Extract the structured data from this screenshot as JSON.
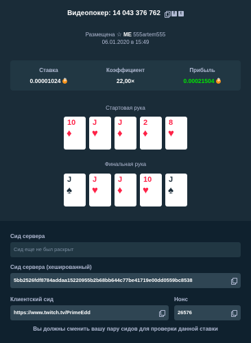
{
  "header": {
    "title": "Видеопокер: 14 043 376 762",
    "placed_prefix": "Размещена",
    "me_label": "ME",
    "username": "555artem555",
    "date": "06.01.2020 в 15:49"
  },
  "stats": {
    "bet_label": "Ставка",
    "bet_value": "0.00001024",
    "multiplier_label": "Коэффициент",
    "multiplier_value": "22,00×",
    "profit_label": "Прибыль",
    "profit_value": "0.00021504",
    "profit_color": "#00e701",
    "coin_color": "#f7931a"
  },
  "start_hand": {
    "label": "Стартовая рука",
    "cards": [
      {
        "rank": "10",
        "suit": "♦",
        "color": "red"
      },
      {
        "rank": "J",
        "suit": "♥",
        "color": "red"
      },
      {
        "rank": "J",
        "suit": "♦",
        "color": "red"
      },
      {
        "rank": "2",
        "suit": "♦",
        "color": "red"
      },
      {
        "rank": "8",
        "suit": "♥",
        "color": "red"
      }
    ]
  },
  "final_hand": {
    "label": "Финальная рука",
    "cards": [
      {
        "rank": "J",
        "suit": "♠",
        "color": "black"
      },
      {
        "rank": "J",
        "suit": "♥",
        "color": "red"
      },
      {
        "rank": "J",
        "suit": "♦",
        "color": "red"
      },
      {
        "rank": "10",
        "suit": "♥",
        "color": "red"
      },
      {
        "rank": "J",
        "suit": "♠",
        "color": "black"
      }
    ]
  },
  "seeds": {
    "server_seed_label": "Сид сервера",
    "server_seed_placeholder": "Сид еще не был раскрыт",
    "server_hash_label": "Сид сервера (хешированный)",
    "server_hash_value": "5bb2526fdf8784addaa15220955b2b68bb644c77be41719e00dd0559bc8538",
    "client_seed_label": "Клиентский сид",
    "client_seed_value": "https://www.twitch.tv/PrimeEdd",
    "nonce_label": "Нонс",
    "nonce_value": "26576",
    "note": "Вы должны сменить вашу пару сидов для проверки данной ставки"
  }
}
